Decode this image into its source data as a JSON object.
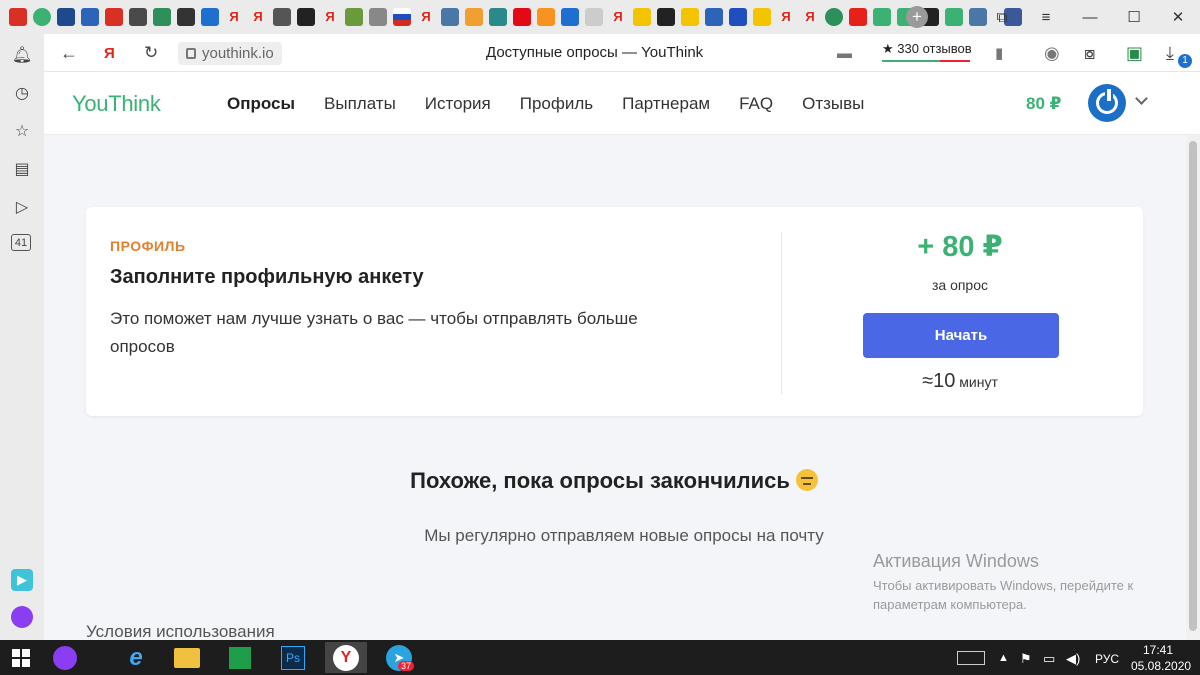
{
  "browser": {
    "url": "youthink.io",
    "page_title": "Доступные опросы — YouThink",
    "reviews_label": "★ 330 отзывов",
    "sidebar_badge": "41",
    "extension_badge": "1"
  },
  "site": {
    "logo": "YouThink",
    "nav": [
      {
        "label": "Опросы",
        "active": true
      },
      {
        "label": "Выплаты",
        "active": false
      },
      {
        "label": "История",
        "active": false
      },
      {
        "label": "Профиль",
        "active": false
      },
      {
        "label": "Партнерам",
        "active": false
      },
      {
        "label": "FAQ",
        "active": false
      },
      {
        "label": "Отзывы",
        "active": false
      }
    ],
    "balance": "80 ₽"
  },
  "card": {
    "eyebrow": "ПРОФИЛЬ",
    "title": "Заполните профильную анкету",
    "description": "Это поможет нам лучше узнать о вас — чтобы отправлять больше опросов",
    "reward": "+ 80 ₽",
    "reward_caption": "за опрос",
    "start_button": "Начать",
    "duration_approx": "≈",
    "duration_value": "10",
    "duration_unit": "минут"
  },
  "empty_state": {
    "title": "Похоже, пока опросы закончились",
    "subtitle": "Мы регулярно отправляем новые опросы на почту"
  },
  "footer": {
    "terms": "Условия использования"
  },
  "windows_watermark": {
    "title": "Активация Windows",
    "line1": "Чтобы активировать Windows, перейдите к",
    "line2": "параметрам компьютера."
  },
  "taskbar": {
    "telegram_badge": "37",
    "language": "РУС",
    "time": "17:41",
    "date": "05.08.2020"
  },
  "colors": {
    "brand_green": "#3bb273",
    "accent_blue": "#4a67e6",
    "eyebrow_orange": "#e0812e"
  }
}
